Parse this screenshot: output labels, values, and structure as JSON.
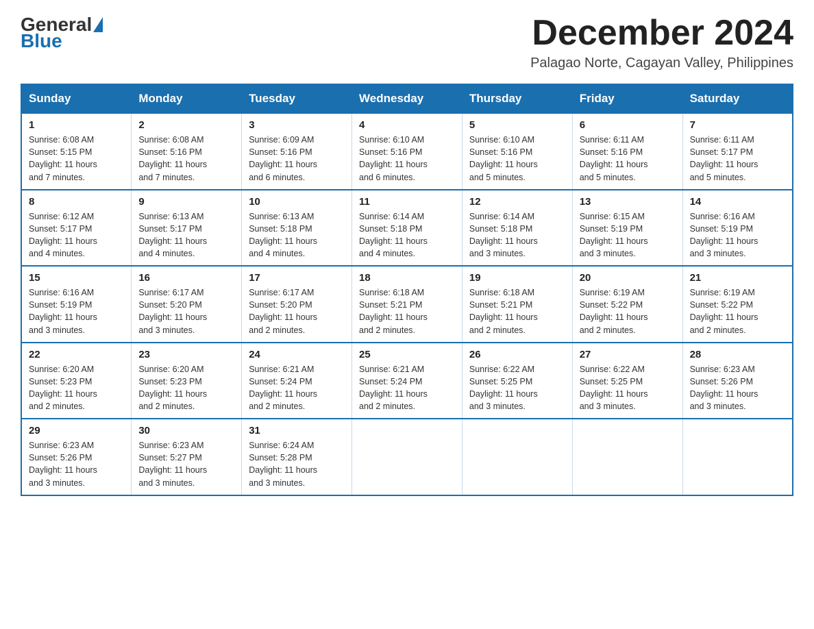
{
  "header": {
    "logo_general": "General",
    "logo_blue": "Blue",
    "month_title": "December 2024",
    "location": "Palagao Norte, Cagayan Valley, Philippines"
  },
  "weekdays": [
    "Sunday",
    "Monday",
    "Tuesday",
    "Wednesday",
    "Thursday",
    "Friday",
    "Saturday"
  ],
  "weeks": [
    [
      {
        "day": "1",
        "sunrise": "6:08 AM",
        "sunset": "5:15 PM",
        "daylight": "11 hours and 7 minutes."
      },
      {
        "day": "2",
        "sunrise": "6:08 AM",
        "sunset": "5:16 PM",
        "daylight": "11 hours and 7 minutes."
      },
      {
        "day": "3",
        "sunrise": "6:09 AM",
        "sunset": "5:16 PM",
        "daylight": "11 hours and 6 minutes."
      },
      {
        "day": "4",
        "sunrise": "6:10 AM",
        "sunset": "5:16 PM",
        "daylight": "11 hours and 6 minutes."
      },
      {
        "day": "5",
        "sunrise": "6:10 AM",
        "sunset": "5:16 PM",
        "daylight": "11 hours and 5 minutes."
      },
      {
        "day": "6",
        "sunrise": "6:11 AM",
        "sunset": "5:16 PM",
        "daylight": "11 hours and 5 minutes."
      },
      {
        "day": "7",
        "sunrise": "6:11 AM",
        "sunset": "5:17 PM",
        "daylight": "11 hours and 5 minutes."
      }
    ],
    [
      {
        "day": "8",
        "sunrise": "6:12 AM",
        "sunset": "5:17 PM",
        "daylight": "11 hours and 4 minutes."
      },
      {
        "day": "9",
        "sunrise": "6:13 AM",
        "sunset": "5:17 PM",
        "daylight": "11 hours and 4 minutes."
      },
      {
        "day": "10",
        "sunrise": "6:13 AM",
        "sunset": "5:18 PM",
        "daylight": "11 hours and 4 minutes."
      },
      {
        "day": "11",
        "sunrise": "6:14 AM",
        "sunset": "5:18 PM",
        "daylight": "11 hours and 4 minutes."
      },
      {
        "day": "12",
        "sunrise": "6:14 AM",
        "sunset": "5:18 PM",
        "daylight": "11 hours and 3 minutes."
      },
      {
        "day": "13",
        "sunrise": "6:15 AM",
        "sunset": "5:19 PM",
        "daylight": "11 hours and 3 minutes."
      },
      {
        "day": "14",
        "sunrise": "6:16 AM",
        "sunset": "5:19 PM",
        "daylight": "11 hours and 3 minutes."
      }
    ],
    [
      {
        "day": "15",
        "sunrise": "6:16 AM",
        "sunset": "5:19 PM",
        "daylight": "11 hours and 3 minutes."
      },
      {
        "day": "16",
        "sunrise": "6:17 AM",
        "sunset": "5:20 PM",
        "daylight": "11 hours and 3 minutes."
      },
      {
        "day": "17",
        "sunrise": "6:17 AM",
        "sunset": "5:20 PM",
        "daylight": "11 hours and 2 minutes."
      },
      {
        "day": "18",
        "sunrise": "6:18 AM",
        "sunset": "5:21 PM",
        "daylight": "11 hours and 2 minutes."
      },
      {
        "day": "19",
        "sunrise": "6:18 AM",
        "sunset": "5:21 PM",
        "daylight": "11 hours and 2 minutes."
      },
      {
        "day": "20",
        "sunrise": "6:19 AM",
        "sunset": "5:22 PM",
        "daylight": "11 hours and 2 minutes."
      },
      {
        "day": "21",
        "sunrise": "6:19 AM",
        "sunset": "5:22 PM",
        "daylight": "11 hours and 2 minutes."
      }
    ],
    [
      {
        "day": "22",
        "sunrise": "6:20 AM",
        "sunset": "5:23 PM",
        "daylight": "11 hours and 2 minutes."
      },
      {
        "day": "23",
        "sunrise": "6:20 AM",
        "sunset": "5:23 PM",
        "daylight": "11 hours and 2 minutes."
      },
      {
        "day": "24",
        "sunrise": "6:21 AM",
        "sunset": "5:24 PM",
        "daylight": "11 hours and 2 minutes."
      },
      {
        "day": "25",
        "sunrise": "6:21 AM",
        "sunset": "5:24 PM",
        "daylight": "11 hours and 2 minutes."
      },
      {
        "day": "26",
        "sunrise": "6:22 AM",
        "sunset": "5:25 PM",
        "daylight": "11 hours and 3 minutes."
      },
      {
        "day": "27",
        "sunrise": "6:22 AM",
        "sunset": "5:25 PM",
        "daylight": "11 hours and 3 minutes."
      },
      {
        "day": "28",
        "sunrise": "6:23 AM",
        "sunset": "5:26 PM",
        "daylight": "11 hours and 3 minutes."
      }
    ],
    [
      {
        "day": "29",
        "sunrise": "6:23 AM",
        "sunset": "5:26 PM",
        "daylight": "11 hours and 3 minutes."
      },
      {
        "day": "30",
        "sunrise": "6:23 AM",
        "sunset": "5:27 PM",
        "daylight": "11 hours and 3 minutes."
      },
      {
        "day": "31",
        "sunrise": "6:24 AM",
        "sunset": "5:28 PM",
        "daylight": "11 hours and 3 minutes."
      },
      null,
      null,
      null,
      null
    ]
  ],
  "labels": {
    "sunrise_prefix": "Sunrise: ",
    "sunset_prefix": "Sunset: ",
    "daylight_prefix": "Daylight: "
  }
}
